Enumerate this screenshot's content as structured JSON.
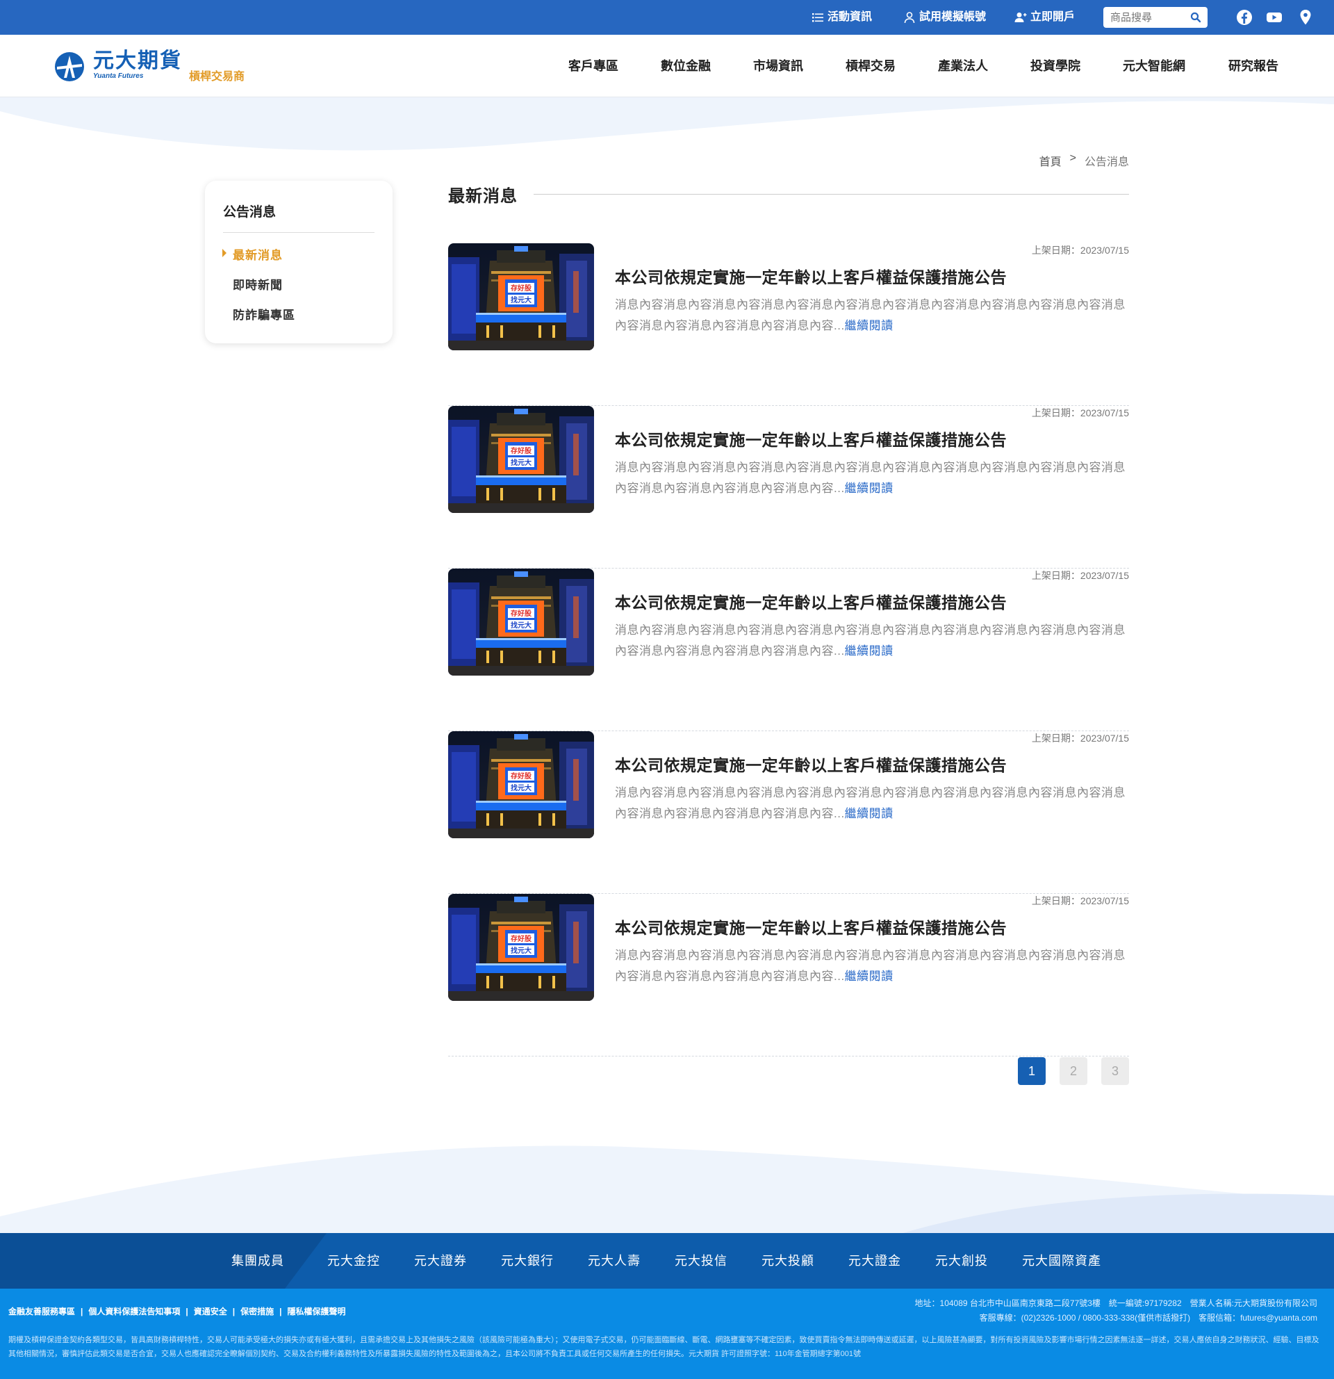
{
  "topbar": {
    "links": [
      "活動資訊",
      "試用模擬帳號",
      "立即開戶"
    ],
    "search_placeholder": "商品搜尋"
  },
  "header": {
    "logo_cn": "元大期貨",
    "logo_en": "Yuanta Futures",
    "logo_sub": "槓桿交易商",
    "nav": [
      "客戶專區",
      "數位金融",
      "市場資訊",
      "槓桿交易",
      "產業法人",
      "投資學院",
      "元大智能網",
      "研究報告"
    ]
  },
  "breadcrumb": {
    "home": "首頁",
    "sep": ">",
    "current": "公告消息"
  },
  "sidebar": {
    "title": "公告消息",
    "items": [
      "最新消息",
      "即時新聞",
      "防詐騙專區"
    ],
    "active_index": 0
  },
  "main": {
    "title": "最新消息",
    "news": [
      {
        "date": "上架日期：2023/07/15",
        "title": "本公司依規定實施一定年齡以上客戶權益保護措施公告",
        "body": "消息內容消息內容消息內容消息內容消息內容消息內容消息內容消息內容消息內容消息內容消息內容消息內容消息內容消息內容消息內容...",
        "more": "繼續閱讀"
      },
      {
        "date": "上架日期：2023/07/15",
        "title": "本公司依規定實施一定年齡以上客戶權益保護措施公告",
        "body": "消息內容消息內容消息內容消息內容消息內容消息內容消息內容消息內容消息內容消息內容消息內容消息內容消息內容消息內容消息內容...",
        "more": "繼續閱讀"
      },
      {
        "date": "上架日期：2023/07/15",
        "title": "本公司依規定實施一定年齡以上客戶權益保護措施公告",
        "body": "消息內容消息內容消息內容消息內容消息內容消息內容消息內容消息內容消息內容消息內容消息內容消息內容消息內容消息內容消息內容...",
        "more": "繼續閱讀"
      },
      {
        "date": "上架日期：2023/07/15",
        "title": "本公司依規定實施一定年齡以上客戶權益保護措施公告",
        "body": "消息內容消息內容消息內容消息內容消息內容消息內容消息內容消息內容消息內容消息內容消息內容消息內容消息內容消息內容消息內容...",
        "more": "繼續閱讀"
      },
      {
        "date": "上架日期：2023/07/15",
        "title": "本公司依規定實施一定年齡以上客戶權益保護措施公告",
        "body": "消息內容消息內容消息內容消息內容消息內容消息內容消息內容消息內容消息內容消息內容消息內容消息內容消息內容消息內容消息內容...",
        "more": "繼續閱讀"
      }
    ],
    "thumb_sign": [
      "存好股",
      "找元大"
    ]
  },
  "pagination": {
    "pages": [
      "1",
      "2",
      "3"
    ],
    "current": "1"
  },
  "group": {
    "label": "集團成員",
    "members": [
      "元大金控",
      "元大證券",
      "元大銀行",
      "元大人壽",
      "元大投信",
      "元大投顧",
      "元大證金",
      "元大創投",
      "元大國際資產"
    ]
  },
  "footer": {
    "links": [
      "金融友善服務專區",
      "個人資料保護法告知事項",
      "資通安全",
      "保密措施",
      "隱私權保護聲明"
    ],
    "address": "地址：104089 台北市中山區南京東路二段77號3樓　統一編號:97179282　營業人名稱:元大期貨股份有限公司",
    "contact": "客服專線：(02)2326-1000 / 0800-333-338(僅供市話撥打)　客服信箱：futures@yuanta.com",
    "disclaimer": "期權及槓桿保證金契約各類型交易，皆具高財務槓桿特性，交易人可能承受極大的損失亦或有極大獲利，且需承擔交易上及其他損失之風險（該風險可能極為重大）；又使用電子式交易，仍可能面臨斷線、斷電、網路壅塞等不確定因素，致使買賣指令無法即時傳送或延遲，以上風險甚為顯要，對所有投資風險及影響市場行情之因素無法逐一詳述，交易人應依自身之財務狀況、經驗、目標及其他相關情況，審慎評估此類交易是否合宜，交易人也應確認完全瞭解個別契約、交易及合約權利義務特性及所暴露損失風險的特性及範圍後為之，且本公司將不負責工具或任何交易所產生的任何損失。元大期貨 許可證照字號：110年金管期總字第001號"
  },
  "colors": {
    "primary": "#2767c0",
    "accent": "#e29b27",
    "group_bar": "#0d5cab",
    "footer": "#0a8be4"
  }
}
